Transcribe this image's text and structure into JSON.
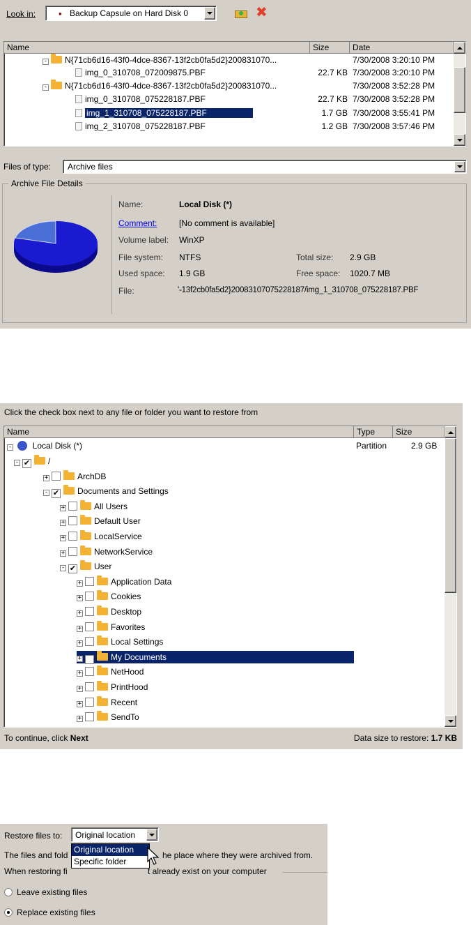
{
  "dialog1": {
    "look_in_label": "Look in:",
    "look_in_value": "Backup Capsule on Hard Disk 0",
    "columns": {
      "name": "Name",
      "size": "Size",
      "date": "Date"
    },
    "rows": [
      {
        "name": "N{71cb6d16-43f0-4dce-8367-13f2cb0fa5d2}200831070...",
        "size": "",
        "date": "7/30/2008 3:20:10 PM",
        "kind": "folder"
      },
      {
        "name": "img_0_310708_072009875.PBF",
        "size": "22.7 KB",
        "date": "7/30/2008 3:20:10 PM",
        "kind": "file"
      },
      {
        "name": "N{71cb6d16-43f0-4dce-8367-13f2cb0fa5d2}200831070...",
        "size": "",
        "date": "7/30/2008 3:52:28 PM",
        "kind": "folder"
      },
      {
        "name": "img_0_310708_075228187.PBF",
        "size": "22.7 KB",
        "date": "7/30/2008 3:52:28 PM",
        "kind": "file"
      },
      {
        "name": "img_1_310708_075228187.PBF",
        "size": "1.7 GB",
        "date": "7/30/2008 3:55:41 PM",
        "kind": "file",
        "selected": true
      },
      {
        "name": "img_2_310708_075228187.PBF",
        "size": "1.2 GB",
        "date": "7/30/2008 3:57:46 PM",
        "kind": "file"
      }
    ],
    "files_of_type_label": "Files of type:",
    "files_of_type_value": "Archive files",
    "details_group_label": "Archive File Details",
    "details": {
      "name_label": "Name:",
      "name_value": "Local Disk (*)",
      "comment_label": "Comment:",
      "comment_value": "[No comment is available]",
      "volume_label": "Volume label:",
      "volume_value": "WinXP",
      "fs_label": "File system:",
      "fs_value": "NTFS",
      "total_label": "Total size:",
      "total_value": "2.9 GB",
      "used_label": "Used space:",
      "used_value": "1.9 GB",
      "free_label": "Free space:",
      "free_value": "1020.7 MB",
      "file_label": "File:",
      "file_value": "'-13f2cb0fa5d2}20083107075228187/img_1_310708_075228187.PBF"
    },
    "pie_used_fraction": 0.655
  },
  "dialog2": {
    "instruction": "Click the check box next to any file or folder you want to restore from",
    "columns": {
      "name": "Name",
      "type": "Type",
      "size": "Size"
    },
    "root": {
      "name": "Local Disk (*)",
      "type": "Partition",
      "size": "2.9 GB"
    },
    "tree": [
      {
        "name": "/",
        "level": 1,
        "checked": true,
        "exp": "-"
      },
      {
        "name": "ArchDB",
        "level": 2,
        "checked": false,
        "exp": "+"
      },
      {
        "name": "Documents and Settings",
        "level": 2,
        "checked": true,
        "exp": "-"
      },
      {
        "name": "All Users",
        "level": 3,
        "checked": false,
        "exp": "+"
      },
      {
        "name": "Default User",
        "level": 3,
        "checked": false,
        "exp": "+"
      },
      {
        "name": "LocalService",
        "level": 3,
        "checked": false,
        "exp": "+"
      },
      {
        "name": "NetworkService",
        "level": 3,
        "checked": false,
        "exp": "+"
      },
      {
        "name": "User",
        "level": 3,
        "checked": true,
        "exp": "-"
      },
      {
        "name": "Application Data",
        "level": 4,
        "checked": false,
        "exp": "+"
      },
      {
        "name": "Cookies",
        "level": 4,
        "checked": false,
        "exp": "+"
      },
      {
        "name": "Desktop",
        "level": 4,
        "checked": false,
        "exp": "+"
      },
      {
        "name": "Favorites",
        "level": 4,
        "checked": false,
        "exp": "+"
      },
      {
        "name": "Local Settings",
        "level": 4,
        "checked": false,
        "exp": "+"
      },
      {
        "name": "My Documents",
        "level": 4,
        "checked": true,
        "exp": "+",
        "selected": true
      },
      {
        "name": "NetHood",
        "level": 4,
        "checked": false,
        "exp": "+"
      },
      {
        "name": "PrintHood",
        "level": 4,
        "checked": false,
        "exp": "+"
      },
      {
        "name": "Recent",
        "level": 4,
        "checked": false,
        "exp": "+"
      },
      {
        "name": "SendTo",
        "level": 4,
        "checked": false,
        "exp": "+"
      }
    ],
    "continue_text": "To continue, click",
    "continue_next": "Next",
    "data_size_label": "Data size to restore:",
    "data_size_value": "1.7 KB"
  },
  "dialog3": {
    "restore_to_label": "Restore files to:",
    "restore_to_value": "Original location",
    "options": [
      "Original location",
      "Specific folder"
    ],
    "desc_left": "The files and fold",
    "desc_right": "he place where they were archived from.",
    "group_left": "When restoring fi",
    "group_right": "t already exist on your computer",
    "radio_leave": "Leave existing files",
    "radio_replace": "Replace existing files",
    "selected_radio": "replace"
  },
  "colors": {
    "selection": "#0a246a",
    "panel": "#d4d0c8",
    "pie": "#1a1ad0"
  }
}
